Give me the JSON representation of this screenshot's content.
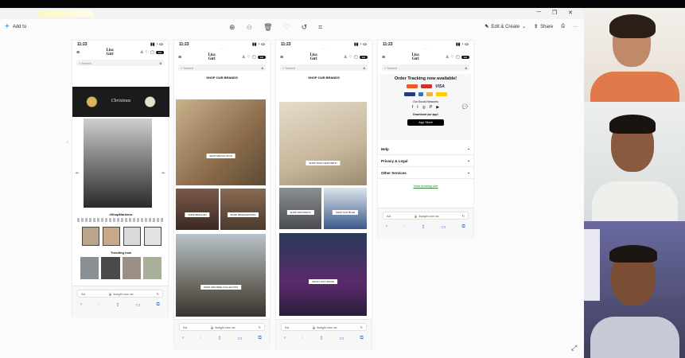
{
  "viewer": {
    "add_to": "Add to",
    "edit_create": "Edit & Create",
    "share": "Share",
    "more": "···"
  },
  "phones": [
    {
      "time": "11:23",
      "logo_line1": "Lisa",
      "logo_line2": "Girl",
      "search": "Search",
      "banner_text": "Christmas",
      "hashtag": "#ShopMarkless",
      "trending": "Trending now",
      "url": "lisagirl.com.tw",
      "aa": "AA"
    },
    {
      "time": "11:23",
      "logo_line1": "Lisa",
      "logo_line2": "Girl",
      "search": "Search",
      "header": "SHOP OUR BRANDS",
      "tags": [
        "SHOP REVOLUTION",
        "SHOP BINGLIAN",
        "SHOP DENIM EDITION",
        "SHOP WELTREE COLLECTION"
      ],
      "url": "lisagirl.com.tw",
      "aa": "AA"
    },
    {
      "time": "11:23",
      "logo_line1": "Lisa",
      "logo_line2": "Girl",
      "search": "Search",
      "header": "SHOP OUR BRANDS",
      "tags": [
        "SHOP DAILY AESTHETIC",
        "SHOP WALKWAYS",
        "SHOP HOT BLUE",
        "SHOP LOST SPACE"
      ],
      "url": "lisagirl.com.tw",
      "aa": "AA"
    },
    {
      "time": "11:23",
      "logo_line1": "Lisa",
      "logo_line2": "Girl",
      "search": "Search",
      "tracking": "Order Tracking now available!",
      "visa": "VISA",
      "social": "Our Social Networks",
      "download": "Download our app!",
      "appstore": "App Store",
      "help": "Help",
      "privacy": "Privacy & Legal",
      "other": "Other Services",
      "desktop": "View desktop site",
      "url": "lisagirl.com.tw",
      "aa": "AA"
    }
  ],
  "colors": {
    "accent": "#1a73e8",
    "card_mastercard": "#eb5b25",
    "card_visa": "#1a1f71",
    "card_paypal": "#253b80",
    "card_dhl": "#ffcc00"
  }
}
